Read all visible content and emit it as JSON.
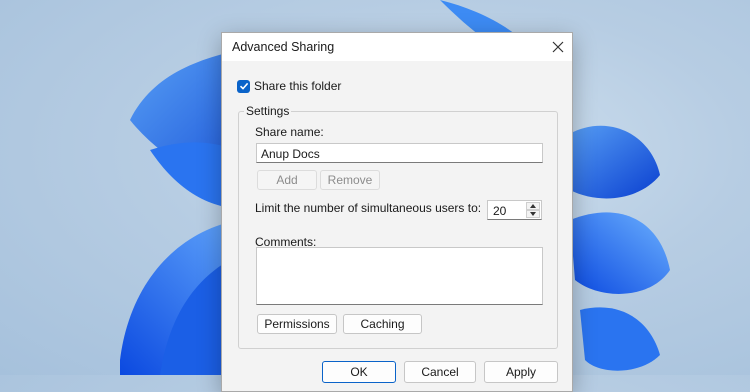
{
  "dialog": {
    "title": "Advanced Sharing",
    "share_checkbox": {
      "label": "Share this folder",
      "checked": true
    },
    "settings": {
      "group_label": "Settings",
      "share_name_label": "Share name:",
      "share_name_value": "Anup Docs",
      "add_label": "Add",
      "remove_label": "Remove",
      "limit_label": "Limit the number of simultaneous users to:",
      "limit_value": "20",
      "comments_label": "Comments:",
      "comments_value": "",
      "permissions_label": "Permissions",
      "caching_label": "Caching"
    },
    "footer": {
      "ok_label": "OK",
      "cancel_label": "Cancel",
      "apply_label": "Apply"
    }
  },
  "icons": {
    "close": "close-icon",
    "checkbox": "checkmark-icon",
    "spin_up": "chevron-up-icon",
    "spin_down": "chevron-down-icon"
  },
  "colors": {
    "accent": "#0a63c9",
    "dialog_bg": "#f3f3f3"
  }
}
